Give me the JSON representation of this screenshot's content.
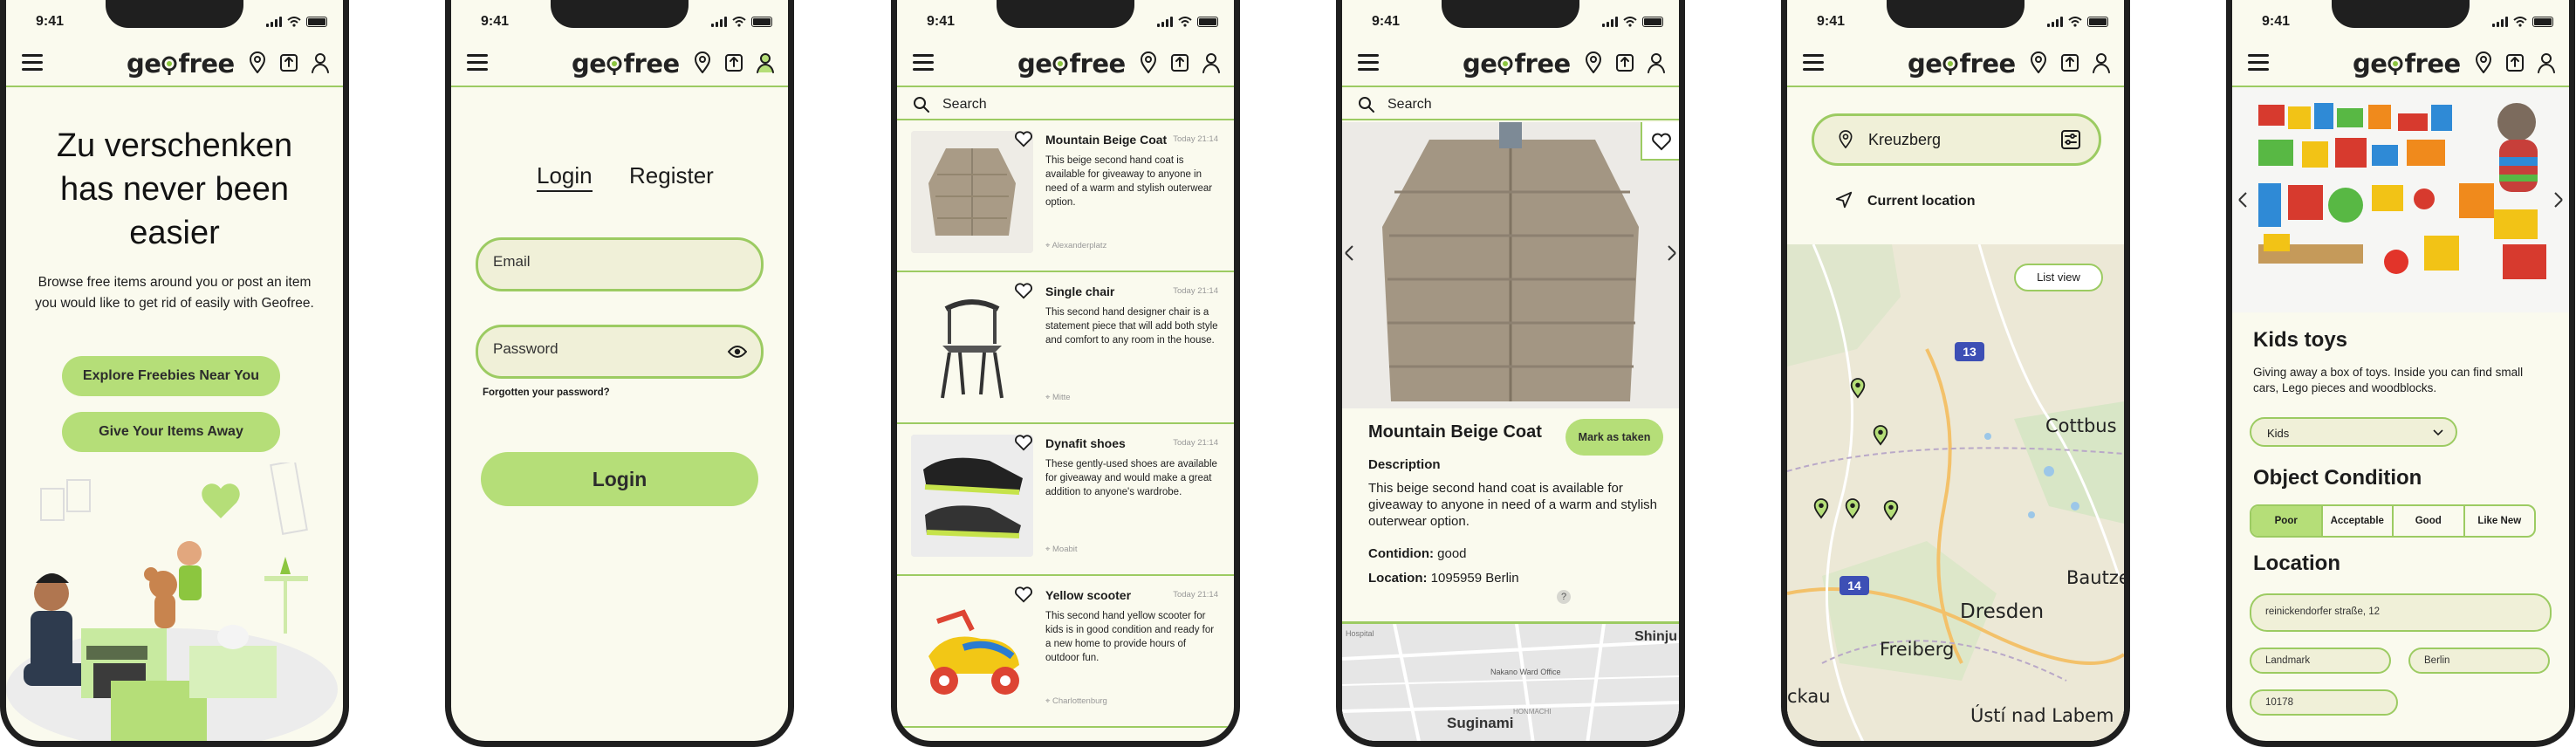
{
  "status": {
    "time": "9:41"
  },
  "logo": {
    "prefix": "ge",
    "suffix": "free"
  },
  "colors": {
    "accent": "#b5de78",
    "border": "#9ccb62",
    "background": "#fafaee",
    "map_badge": "#3d4fb5"
  },
  "nav_icons": [
    "map-pin-icon",
    "upload-icon",
    "user-icon"
  ],
  "landing": {
    "title": "Zu verschenken has never been easier",
    "text": "Browse free items around you or post an item you would like to get rid of easily with Geofree.",
    "btn_explore": "Explore Freebies Near You",
    "btn_give": "Give Your Items Away"
  },
  "login": {
    "tab_login": "Login",
    "tab_register": "Register",
    "email_placeholder": "Email",
    "password_placeholder": "Password",
    "forgot": "Forgotten your password?",
    "submit": "Login"
  },
  "search": {
    "placeholder": "Search"
  },
  "list": {
    "items": [
      {
        "title": "Mountain Beige Coat",
        "date": "Today 21:14",
        "desc": "This beige second hand coat is available for giveaway to anyone in need of a warm and stylish outerwear option.",
        "location": "Alexanderplatz"
      },
      {
        "title": "Single chair",
        "date": "Today 21:14",
        "desc": "This second hand designer chair is a statement piece that will add both style and comfort to any room in the house.",
        "location": "Mitte"
      },
      {
        "title": "Dynafit shoes",
        "date": "Today 21:14",
        "desc": "These gently-used shoes are available for giveaway and would make a great addition to anyone's wardrobe.",
        "location": "Moabit"
      },
      {
        "title": "Yellow scooter",
        "date": "Today 21:14",
        "desc": "This second hand yellow scooter for kids is in good condition and ready for a new home to provide hours of outdoor fun.",
        "location": "Charlottenburg"
      }
    ]
  },
  "detail": {
    "title": "Mountain Beige Coat",
    "mark_taken": "Mark as taken",
    "description_label": "Description",
    "description": "This beige second hand coat is available for giveaway to anyone in need of a warm and stylish outerwear option.",
    "condition_label": "Contidion:",
    "condition": "good",
    "location_label": "Location:",
    "location": "1095959 Berlin",
    "help": "?",
    "map_labels": [
      "Hospital",
      "Shinju",
      "Nakano Ward Office",
      "Suginami",
      "HONMACHI"
    ]
  },
  "map_screen": {
    "location_value": "Kreuzberg",
    "current_location": "Current location",
    "list_view": "List view",
    "cities": [
      "Cottbus",
      "Bautze",
      "Dresden",
      "Freiberg",
      "Ústí nad Labem",
      "ckau"
    ],
    "road_numbers": [
      "13",
      "14"
    ]
  },
  "post_item": {
    "title": "Kids toys",
    "text": "Giving away a box of toys. Inside you can find small cars, Lego pieces and woodblocks.",
    "category": "Kids",
    "condition_heading": "Object Condition",
    "conditions": [
      "Poor",
      "Acceptable",
      "Good",
      "Like New"
    ],
    "location_heading": "Location",
    "street": "reinickendorfer straße, 12",
    "state": "Landmark",
    "city": "Berlin",
    "zip": "10178"
  }
}
